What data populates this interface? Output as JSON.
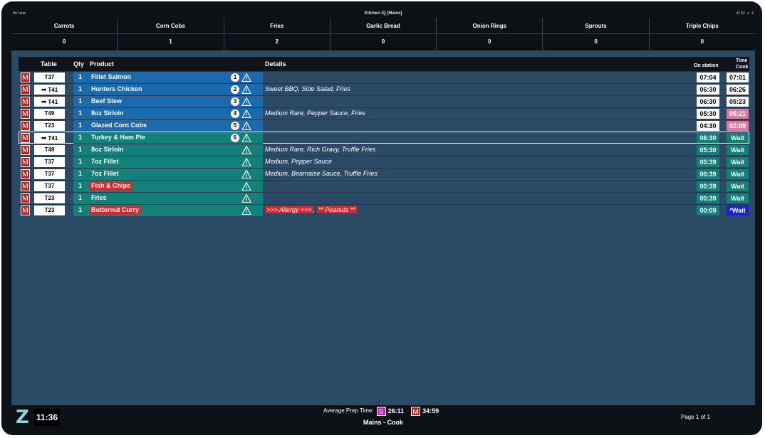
{
  "topbar": {
    "status": "Online",
    "title": "Kitchen iQ [Mains]",
    "clock": "4:32 > 2"
  },
  "summary": [
    {
      "name": "Carrots",
      "count": "0"
    },
    {
      "name": "Corn Cobs",
      "count": "1"
    },
    {
      "name": "Fries",
      "count": "2"
    },
    {
      "name": "Garlic Bread",
      "count": "0"
    },
    {
      "name": "Onion Rings",
      "count": "0"
    },
    {
      "name": "Sprouts",
      "count": "0"
    },
    {
      "name": "Triple Chips",
      "count": "0"
    }
  ],
  "headers": {
    "table": "Table",
    "qty": "Qty",
    "product": "Product",
    "details": "Details",
    "on_station": "On station",
    "time": "Time",
    "cook": "Cook"
  },
  "badge_letter": "M",
  "transfer_glyph": "➡",
  "orders": [
    {
      "table": "T37",
      "transfer": false,
      "qty": "1",
      "product": "Fillet Salmon",
      "seq": "1",
      "details": "",
      "on_station": "07:04",
      "cook": "07:01",
      "band": "blue",
      "cook_style": "white"
    },
    {
      "table": "T41",
      "transfer": true,
      "qty": "1",
      "product": "Hunters Chicken",
      "seq": "2",
      "details": "Sweet BBQ, Side Salad, Fries",
      "on_station": "06:30",
      "cook": "06:26",
      "band": "blue",
      "cook_style": "white"
    },
    {
      "table": "T41",
      "transfer": true,
      "qty": "1",
      "product": "Beef Stew",
      "seq": "3",
      "details": "",
      "on_station": "06:30",
      "cook": "05:23",
      "band": "blue",
      "cook_style": "white"
    },
    {
      "table": "T49",
      "transfer": false,
      "qty": "1",
      "product": "8oz Sirloin",
      "seq": "4",
      "details": "Medium Rare, Pepper Sauce, Fries",
      "on_station": "05:30",
      "cook": "05:21",
      "band": "blue",
      "cook_style": "pink"
    },
    {
      "table": "T23",
      "transfer": false,
      "qty": "1",
      "product": "Glazed Corn Cobs",
      "seq": "5",
      "details": "",
      "on_station": "04:30",
      "cook": "02:09",
      "band": "blue",
      "cook_style": "pink"
    },
    {
      "table": "T41",
      "transfer": true,
      "qty": "1",
      "product": "Turkey & Ham Pie",
      "seq": "6",
      "details": "",
      "on_station": "06:30",
      "cook": "Wait",
      "band": "teal",
      "cook_style": "wait",
      "selected": true
    },
    {
      "table": "T49",
      "transfer": false,
      "qty": "1",
      "product": "8oz Sirloin",
      "seq": "",
      "details": "Medium Rare, Rich Gravy, Truffle Fries",
      "on_station": "05:30",
      "cook": "Wait",
      "band": "teal",
      "cook_style": "wait"
    },
    {
      "table": "T37",
      "transfer": false,
      "qty": "1",
      "product": "7oz Fillet",
      "seq": "",
      "details": "Medium, Pepper Sauce",
      "on_station": "00:39",
      "cook": "Wait",
      "band": "teal",
      "cook_style": "wait"
    },
    {
      "table": "T37",
      "transfer": false,
      "qty": "1",
      "product": "7oz Fillet",
      "seq": "",
      "details": "Medium, Bearnaise Sauce, Truffle Fries",
      "on_station": "00:39",
      "cook": "Wait",
      "band": "teal",
      "cook_style": "wait"
    },
    {
      "table": "T37",
      "transfer": false,
      "qty": "1",
      "product": "Fish & Chips",
      "seq": "",
      "details": "",
      "on_station": "00:39",
      "cook": "Wait",
      "band": "teal",
      "cook_style": "wait",
      "allergy_product": true
    },
    {
      "table": "T23",
      "transfer": false,
      "qty": "1",
      "product": "Fries",
      "seq": "",
      "details": "",
      "on_station": "00:39",
      "cook": "Wait",
      "band": "teal",
      "cook_style": "wait"
    },
    {
      "table": "T23",
      "transfer": false,
      "qty": "1",
      "product": "Butternut Curry",
      "seq": "",
      "details": "",
      "allergy_details": [
        ">>> Allergy <<<",
        "** Peanuts **"
      ],
      "on_station": "00:09",
      "cook": "*Wait",
      "band": "teal",
      "cook_style": "waitblue",
      "allergy_product": true
    }
  ],
  "footer": {
    "logo": "Z",
    "time": "11:36",
    "avg_label": "Average Prep Time:",
    "s_badge": "S",
    "s_time": "26:11",
    "m_badge": "M",
    "m_time": "34:59",
    "station": "Mains - Cook",
    "page": "Page 1 of 1"
  },
  "colors": {
    "blue_band": "#1b6aae",
    "teal_band": "#138079",
    "red": "#c8201d",
    "pink": "#e07ca4",
    "wait_blue": "#1622d4",
    "panel": "#2b4a66"
  }
}
